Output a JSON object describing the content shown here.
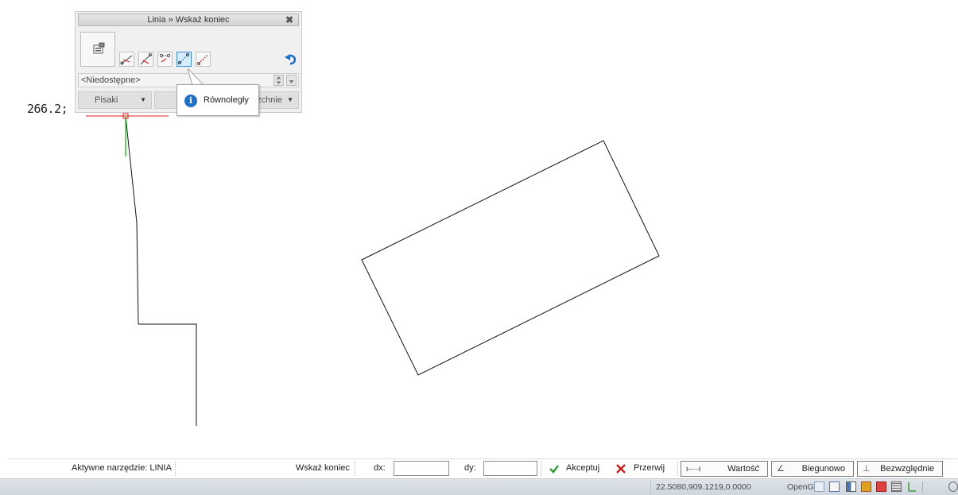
{
  "panel": {
    "title": "Linia » Wskaż koniec",
    "close_glyph": "✖",
    "combo_value": "<Niedostępne>",
    "drop_pens": "Pisaki",
    "drop_mid": "Cz",
    "drop_right": "zchnie",
    "active_tool": "parallel-tool"
  },
  "tooltip": {
    "text": "Równoległy"
  },
  "canvas": {
    "coord_readout": "266.2;"
  },
  "command_bar": {
    "active_tool": "Aktywne narzędzie: LINIA",
    "prompt": "Wskaż koniec",
    "dx_label": "dx:",
    "dx_value": "",
    "dy_label": "dy:",
    "dy_value": "",
    "accept_label": "Akceptuj",
    "cancel_label": "Przerwij",
    "value_label": "Wartość",
    "polar_label": "Biegunowo",
    "absolute_label": "Bezwzględnie"
  },
  "status_bar": {
    "coordinates": "22.5080,909.1219,0.0000",
    "renderer": "OpenGL"
  },
  "colors": {
    "accept": "#2e9e2e",
    "cancel": "#c81e1e",
    "accent": "#1e6fcc",
    "snap_line": "#e02020",
    "direction_line": "#2ecc2e"
  }
}
